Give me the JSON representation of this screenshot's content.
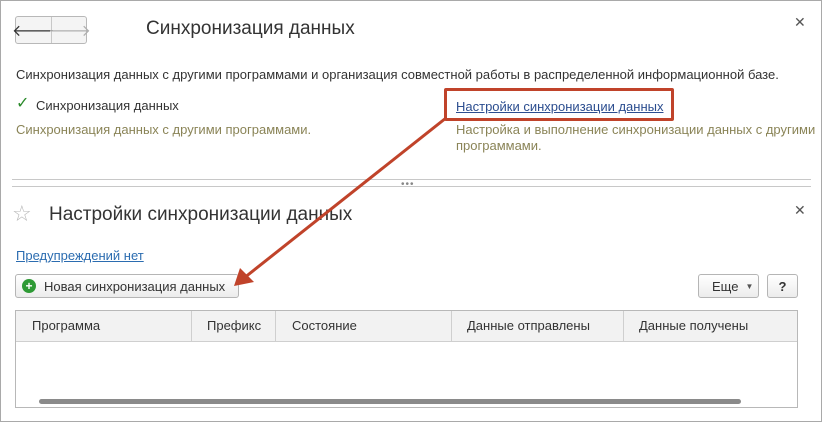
{
  "top_panel": {
    "title": "Синхронизация данных",
    "description": "Синхронизация данных с другими программами и организация совместной работы в распределенной информационной базе.",
    "checkbox_label": "Синхронизация данных",
    "checkbox_checked": true,
    "checkbox_note": "Синхронизация данных с другими программами.",
    "settings_link": "Настройки синхронизации данных",
    "settings_note": "Настройка и выполнение синхронизации данных с другими программами."
  },
  "bottom_panel": {
    "title": "Настройки синхронизации данных",
    "warnings_link": "Предупреждений нет",
    "new_sync_button": "Новая синхронизация данных",
    "more_button": "Еще",
    "help_button": "?",
    "table_columns": [
      "Программа",
      "Префикс",
      "Состояние",
      "Данные отправлены",
      "Данные получены"
    ],
    "table_rows": []
  },
  "icons": {
    "back": "arrow-left-icon",
    "forward": "arrow-right-icon",
    "close": "close-icon",
    "favorite": "star-icon",
    "add": "plus-circle-icon",
    "dropdown": "caret-down-icon",
    "checkbox": "checkmark-icon"
  },
  "colors": {
    "highlight": "#c0432a",
    "link": "#2b4d8f",
    "note_text": "#8a8457",
    "add_icon": "#2e9a35",
    "check": "#2b8a2b"
  }
}
